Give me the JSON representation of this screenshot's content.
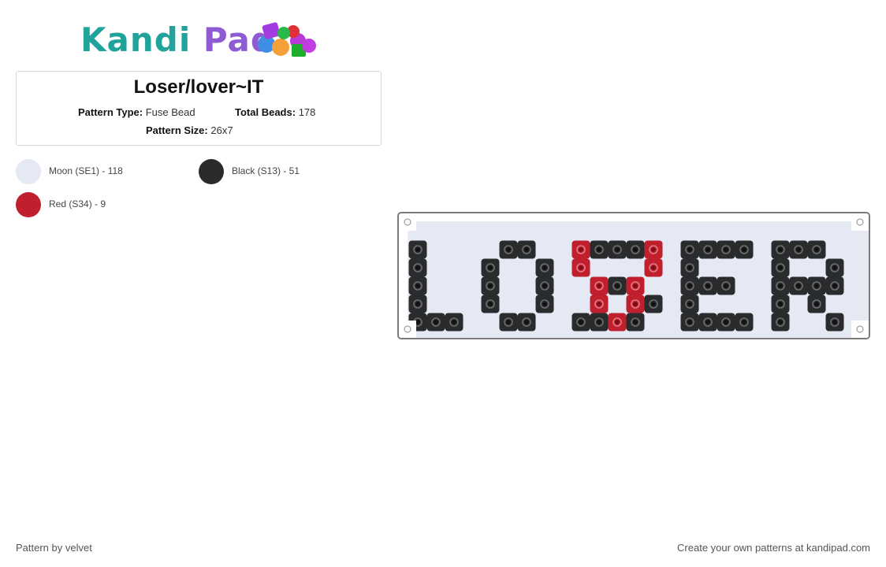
{
  "logo": {
    "text_part1": "Kandi",
    "text_part2": "Pad"
  },
  "pattern": {
    "title": "Loser/lover~IT",
    "type_label": "Pattern Type:",
    "type_value": "Fuse Bead",
    "beads_label": "Total Beads:",
    "beads_value": "178",
    "size_label": "Pattern Size:",
    "size_value": "26x7"
  },
  "legend": [
    {
      "label": "Moon (SE1) - 118",
      "color": "#e4e9f3"
    },
    {
      "label": "Black (S13) - 51",
      "color": "#2a2b2d"
    },
    {
      "label": "Red (S34) - 9",
      "color": "#c0202e"
    }
  ],
  "grid": {
    "cols": 26,
    "rows": 7,
    "colors": {
      "M": "#e4e9f3",
      "B": "#2a2b2d",
      "R": "#c0202e"
    },
    "cells": [
      "MMMMMMMMMMMMMMMMMMMMMMMMMM",
      "BMMMMBBMMRBBBRMBBBBMBBBMMM",
      "BMMMBMMBMRMMMRMBMMMMBMMBMM",
      "BMMMBMMBMMRBRMMBBBMMBBBBMM",
      "BMMMBMMBMMRMRBMBMMMMBMBMMM",
      "BBBMMBBMMBBRBMMBBBBMBMMBMM",
      "MMMMMMMMMMMMMMMMMMMMMMMMMM"
    ]
  },
  "footer": {
    "left": "Pattern by velvet",
    "right": "Create your own patterns at kandipad.com"
  }
}
